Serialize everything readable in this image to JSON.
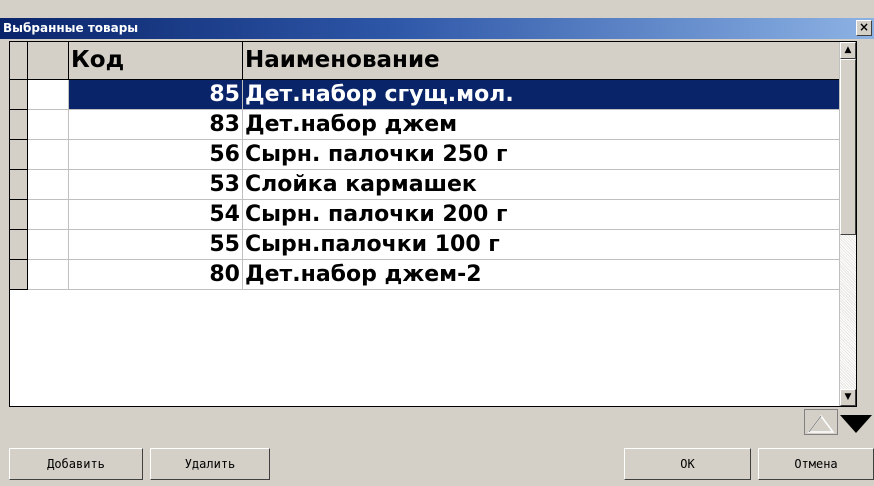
{
  "window": {
    "title": "Выбранные товары",
    "close_glyph": "×"
  },
  "grid": {
    "columns": [
      "",
      "",
      "Код",
      "Наименование"
    ],
    "rows": [
      {
        "code": "85",
        "name": "Дет.набор сгущ.мол.",
        "selected": true
      },
      {
        "code": "83",
        "name": "Дет.набор джем",
        "selected": false
      },
      {
        "code": "56",
        "name": "Сырн. палочки 250 г",
        "selected": false
      },
      {
        "code": "53",
        "name": "Слойка кармашек",
        "selected": false
      },
      {
        "code": "54",
        "name": "Сырн. палочки 200 г",
        "selected": false
      },
      {
        "code": "55",
        "name": "Сырн.палочки 100 г",
        "selected": false
      },
      {
        "code": "80",
        "name": "Дет.набор джем-2",
        "selected": false
      }
    ]
  },
  "buttons": {
    "add": "Добавить",
    "delete": "Удалить",
    "ok": "OK",
    "cancel": "Отмена"
  },
  "colors": {
    "title_start": "#0a246a",
    "title_end": "#8cb2e4",
    "selection": "#0a246a",
    "face": "#d4d0c8"
  }
}
